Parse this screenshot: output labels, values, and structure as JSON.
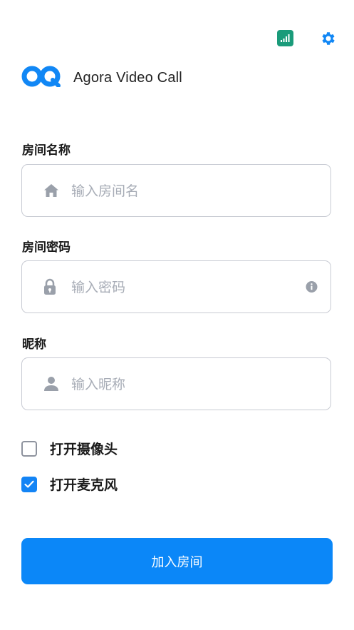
{
  "header": {
    "app_title": "Agora Video Call",
    "icons": {
      "network": "network-quality-icon",
      "settings": "gear-icon",
      "logo": "agora-logo-icon"
    }
  },
  "form": {
    "room_name": {
      "label": "房间名称",
      "placeholder": "输入房间名",
      "icon": "home-icon"
    },
    "room_password": {
      "label": "房间密码",
      "placeholder": "输入密码",
      "icon": "lock-icon",
      "trailing_icon": "info-icon"
    },
    "nickname": {
      "label": "昵称",
      "placeholder": "输入昵称",
      "icon": "person-icon"
    }
  },
  "options": {
    "camera": {
      "label": "打开摄像头",
      "checked": false
    },
    "microphone": {
      "label": "打开麦克风",
      "checked": true
    }
  },
  "actions": {
    "join_label": "加入房间"
  },
  "colors": {
    "accent": "#0b87f8",
    "brand_blue": "#1187f5",
    "network_green": "#1a9b7a",
    "placeholder": "#a7acb6"
  }
}
